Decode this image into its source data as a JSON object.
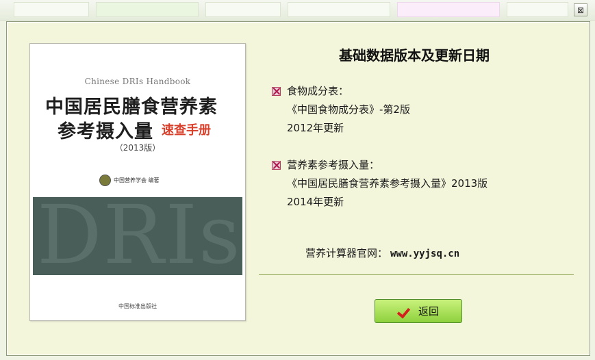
{
  "window": {
    "close_glyph": "⊠"
  },
  "dialog": {
    "heading": "基础数据版本及更新日期",
    "sections": [
      {
        "lines": [
          "食物成分表：",
          "《中国食物成分表》-第2版",
          "2012年更新"
        ]
      },
      {
        "lines": [
          "营养素参考摄入量：",
          "《中国居民膳食营养素参考摄入量》2013版",
          "2014年更新"
        ]
      }
    ],
    "website_label": "营养计算器官网：",
    "website_url": "www.yyjsq.cn",
    "return_label": "返回"
  },
  "book": {
    "english_title": "Chinese DRIs Handbook",
    "title_line1": "中国居民膳食营养素",
    "title_line2": "参考摄入量",
    "title_accent": "速查手册",
    "edition": "（2013版）",
    "author": "中国营养学会  编著",
    "band_text": "DRIs",
    "press": "中国标准出版社"
  },
  "colors": {
    "accent_button": "#8ed13d",
    "bullet": "#b0184a",
    "book_band": "#4a5e59",
    "check": "#d3201d"
  }
}
